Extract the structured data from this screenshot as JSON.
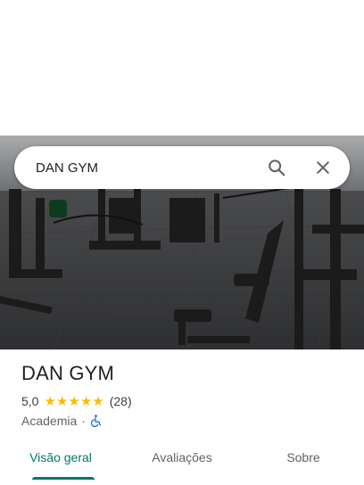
{
  "search": {
    "value": "DAN GYM",
    "icons": {
      "search": "search-icon",
      "close": "close-icon"
    }
  },
  "place": {
    "name": "DAN GYM",
    "rating": "5,0",
    "rating_value": 5.0,
    "stars_max": 5,
    "review_count": "(28)",
    "category": "Academia",
    "separator": "·",
    "accessibility_icon": "wheelchair-icon"
  },
  "tabs": [
    {
      "label": "Visão geral",
      "active": true
    },
    {
      "label": "Avaliações",
      "active": false
    },
    {
      "label": "Sobre",
      "active": false
    }
  ],
  "colors": {
    "accent": "#00796b",
    "star": "#fbbc04",
    "accessibility": "#1a73e8"
  }
}
